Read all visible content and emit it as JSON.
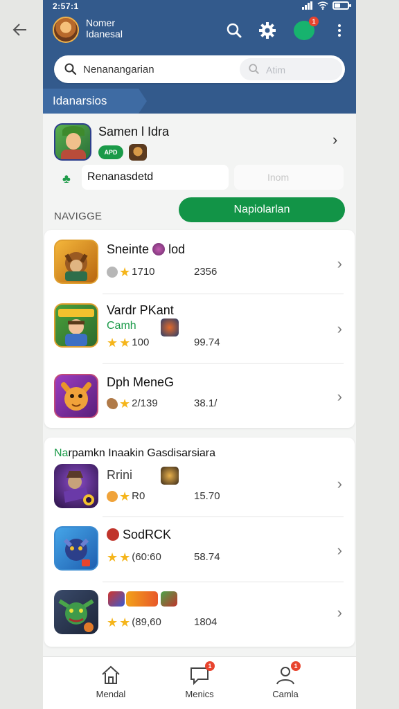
{
  "status_bar": {
    "time": "2:57:1"
  },
  "header": {
    "profile_name": "Nomer",
    "profile_sub": "Idanesal",
    "chat_badge": "1"
  },
  "search": {
    "value": "Nenanangarian",
    "secondary_placeholder": "Atim"
  },
  "section_tag": "Idanarsios",
  "featured": {
    "title": "Samen l Idra",
    "pill": "APD",
    "field_value": "Renanasdetd",
    "field2_placeholder": "Inom"
  },
  "nav_label": "NAVIGGE",
  "primary_button": "Napiolarlan",
  "list1": [
    {
      "title": "Sneinte",
      "title_suffix": "lod",
      "rating": "1710",
      "value": "2356"
    },
    {
      "title": "Vardr PKant",
      "subtitle": "Camh",
      "rating": "100",
      "value": "99.74"
    },
    {
      "title": "Dph MeneG",
      "rating": "2/139",
      "value": "38.1/"
    }
  ],
  "list2_title": {
    "accent": "Na",
    "rest": "rpamkn Inaakin Gasdisarsiara"
  },
  "list2": [
    {
      "title": "Rrini",
      "rating": "R0",
      "value": "15.70"
    },
    {
      "title": "SodRCK",
      "rating": "(60:60",
      "value": "58.74"
    },
    {
      "title": "",
      "rating": "(89,60",
      "value": "1804"
    }
  ],
  "bottom_nav": [
    {
      "label": "Mendal",
      "icon": "home-icon",
      "badge": ""
    },
    {
      "label": "Menics",
      "icon": "chat-icon",
      "badge": "1"
    },
    {
      "label": "Camla",
      "icon": "profile-icon",
      "badge": "1"
    }
  ],
  "colors": {
    "header": "#335a8c",
    "accent_green": "#129447",
    "badge_red": "#e8442e",
    "star": "#f5b51b"
  }
}
